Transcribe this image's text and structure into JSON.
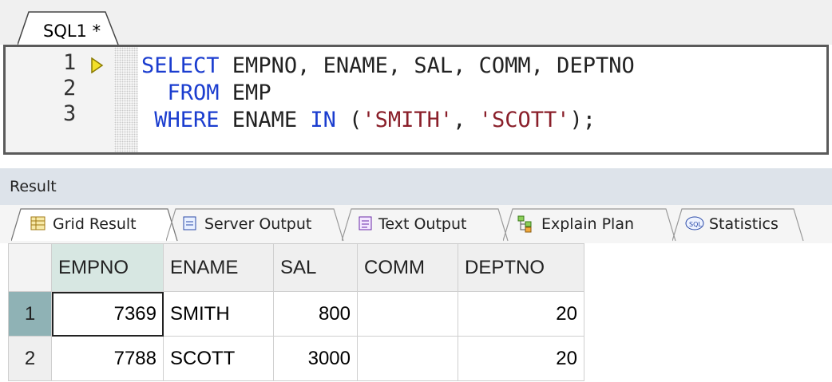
{
  "editor": {
    "tab_label": "SQL1 *",
    "lines": [
      {
        "num": "1",
        "tokens": [
          {
            "t": "SELECT",
            "c": "kw"
          },
          {
            "t": " EMPNO, ENAME, SAL, COMM, DEPTNO",
            "c": "id"
          }
        ]
      },
      {
        "num": "2",
        "tokens": [
          {
            "t": "  FROM",
            "c": "kw"
          },
          {
            "t": " EMP",
            "c": "id"
          }
        ]
      },
      {
        "num": "3",
        "tokens": [
          {
            "t": " WHERE",
            "c": "kw"
          },
          {
            "t": " ENAME ",
            "c": "id"
          },
          {
            "t": "IN",
            "c": "kw"
          },
          {
            "t": " (",
            "c": "id"
          },
          {
            "t": "'SMITH'",
            "c": "str"
          },
          {
            "t": ", ",
            "c": "id"
          },
          {
            "t": "'SCOTT'",
            "c": "str"
          },
          {
            "t": ");",
            "c": "id"
          }
        ]
      }
    ]
  },
  "result": {
    "title": "Result",
    "tabs": [
      {
        "label": "Grid Result",
        "icon": "grid-result-icon",
        "active": true
      },
      {
        "label": "Server Output",
        "icon": "server-output-icon",
        "active": false
      },
      {
        "label": "Text Output",
        "icon": "text-output-icon",
        "active": false
      },
      {
        "label": "Explain Plan",
        "icon": "explain-plan-icon",
        "active": false
      },
      {
        "label": "Statistics",
        "icon": "statistics-icon",
        "active": false
      }
    ]
  },
  "grid": {
    "columns": [
      "EMPNO",
      "ENAME",
      "SAL",
      "COMM",
      "DEPTNO"
    ],
    "rows": [
      {
        "rownum": "1",
        "cells": [
          "7369",
          "SMITH",
          "800",
          "",
          "20"
        ]
      },
      {
        "rownum": "2",
        "cells": [
          "7788",
          "SCOTT",
          "3000",
          "",
          "20"
        ]
      }
    ]
  },
  "colors": {
    "keyword": "#1b3dcf",
    "string": "#8a1f2a",
    "selected_header": "#d7e7e2",
    "selected_row_marker": "#8fb2b5"
  }
}
